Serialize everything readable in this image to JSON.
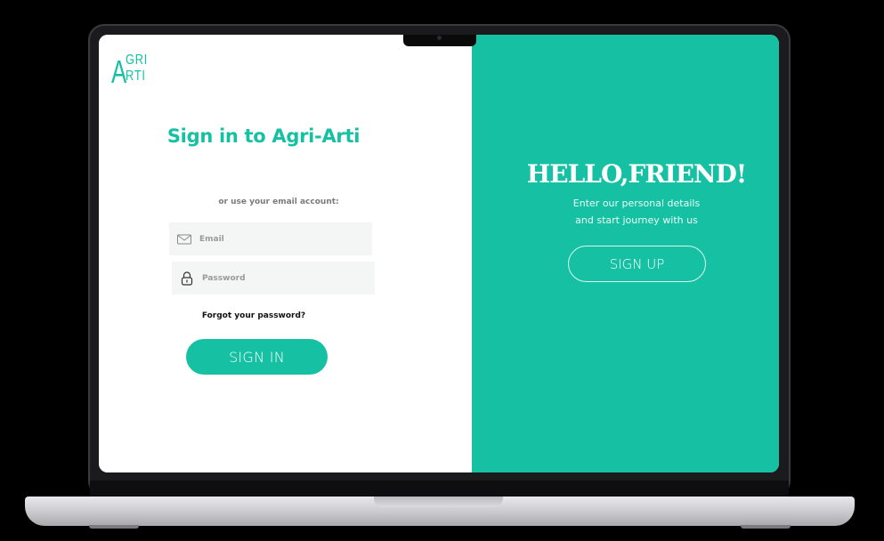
{
  "brand": {
    "logo_initial": "A",
    "logo_line1": "GRI",
    "logo_line2": "RTI",
    "accent_color": "#16c1a3"
  },
  "signin": {
    "title": "Sign in to Agri-Arti",
    "subtitle": "or use your email account:",
    "email_placeholder": "Email",
    "email_icon": "mail-icon",
    "password_placeholder": "Password",
    "password_icon": "lock-icon",
    "forgot_label": "Forgot your password?",
    "button_label": "SIGN IN"
  },
  "welcome": {
    "heading": "HELLO,FRIEND!",
    "line1": "Enter our personal details",
    "line2": "and start journey with us",
    "button_label": "SIGN UP"
  }
}
